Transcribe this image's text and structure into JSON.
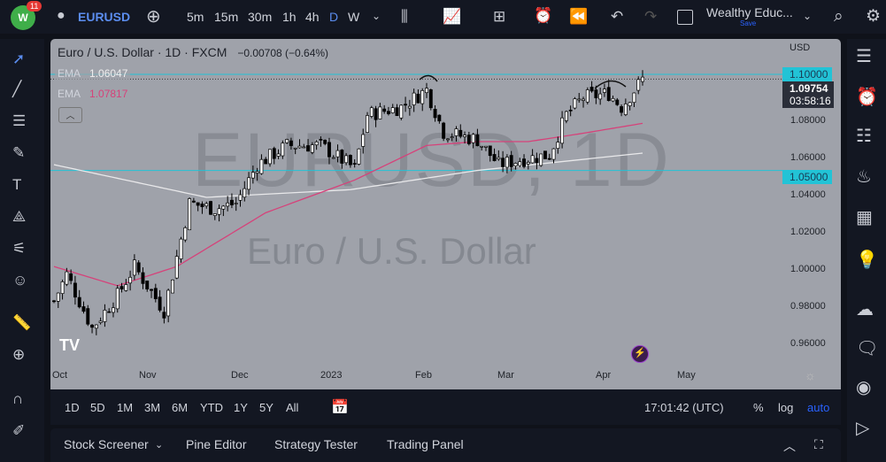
{
  "header": {
    "notifications": "11",
    "symbol": "EURUSD",
    "timeframes": [
      "5m",
      "15m",
      "30m",
      "1h",
      "4h",
      "D",
      "W"
    ],
    "active_timeframe": "D",
    "layout_name": "Wealthy Educ...",
    "save_label": "Save"
  },
  "legend": {
    "title": "Euro / U.S. Dollar",
    "interval": "1D",
    "exchange": "FXCM",
    "change": "−0.00708 (−0.64%)",
    "ema1_label": "EMA",
    "ema1_value": "1.06047",
    "ema2_label": "EMA",
    "ema2_value": "1.07817"
  },
  "watermark": {
    "symbol": "EURUSD, 1D",
    "description": "Euro / U.S. Dollar"
  },
  "price_axis": {
    "currency": "USD",
    "labels": [
      "1.08000",
      "1.06000",
      "1.04000",
      "1.02000",
      "1.00000",
      "0.98000",
      "0.96000"
    ],
    "alert_level": "1.10000",
    "support_level": "1.05000",
    "last_price": "1.09754",
    "countdown": "03:58:16"
  },
  "time_axis": [
    "Oct",
    "Nov",
    "Dec",
    "2023",
    "Feb",
    "Mar",
    "Apr",
    "May"
  ],
  "ranges": [
    "1D",
    "5D",
    "1M",
    "3M",
    "6M",
    "YTD",
    "1Y",
    "5Y",
    "All"
  ],
  "clock": "17:01:42 (UTC)",
  "scale_options": {
    "percent": "%",
    "log": "log",
    "auto": "auto"
  },
  "panel_tabs": [
    "Stock Screener",
    "Pine Editor",
    "Strategy Tester",
    "Trading Panel"
  ],
  "colors": {
    "up": "#ffffff",
    "down": "#000000",
    "ema_slow": "#e8e8ea",
    "ema_fast": "#d6427a",
    "hline": "#22c3d6",
    "accent": "#2962ff"
  },
  "chart_data": {
    "type": "candlestick",
    "bars": 140,
    "close_anchors": [
      [
        0,
        0.982
      ],
      [
        3,
        0.996
      ],
      [
        9,
        0.968
      ],
      [
        15,
        0.985
      ],
      [
        19,
        1.0
      ],
      [
        26,
        0.977
      ],
      [
        32,
        1.033
      ],
      [
        38,
        1.03
      ],
      [
        43,
        1.033
      ],
      [
        48,
        1.053
      ],
      [
        55,
        1.063
      ],
      [
        63,
        1.063
      ],
      [
        71,
        1.051
      ],
      [
        74,
        1.079
      ],
      [
        82,
        1.083
      ],
      [
        88,
        1.092
      ],
      [
        92,
        1.07
      ],
      [
        100,
        1.066
      ],
      [
        105,
        1.053
      ],
      [
        111,
        1.056
      ],
      [
        117,
        1.058
      ],
      [
        121,
        1.079
      ],
      [
        125,
        1.088
      ],
      [
        131,
        1.09
      ],
      [
        134,
        1.083
      ],
      [
        139,
        1.0975
      ]
    ],
    "ema_slow": [
      [
        0,
        1.053
      ],
      [
        36,
        1.036
      ],
      [
        70,
        1.04
      ],
      [
        100,
        1.05
      ],
      [
        139,
        1.059
      ]
    ],
    "ema_fast": [
      [
        0,
        1.0
      ],
      [
        15,
        0.99
      ],
      [
        29,
        1.0
      ],
      [
        50,
        1.028
      ],
      [
        71,
        1.045
      ],
      [
        88,
        1.063
      ],
      [
        100,
        1.065
      ],
      [
        112,
        1.065
      ],
      [
        124,
        1.069
      ],
      [
        139,
        1.0745
      ]
    ],
    "hlines": [
      1.1,
      1.05
    ],
    "ylim": [
      0.95,
      1.11
    ]
  }
}
